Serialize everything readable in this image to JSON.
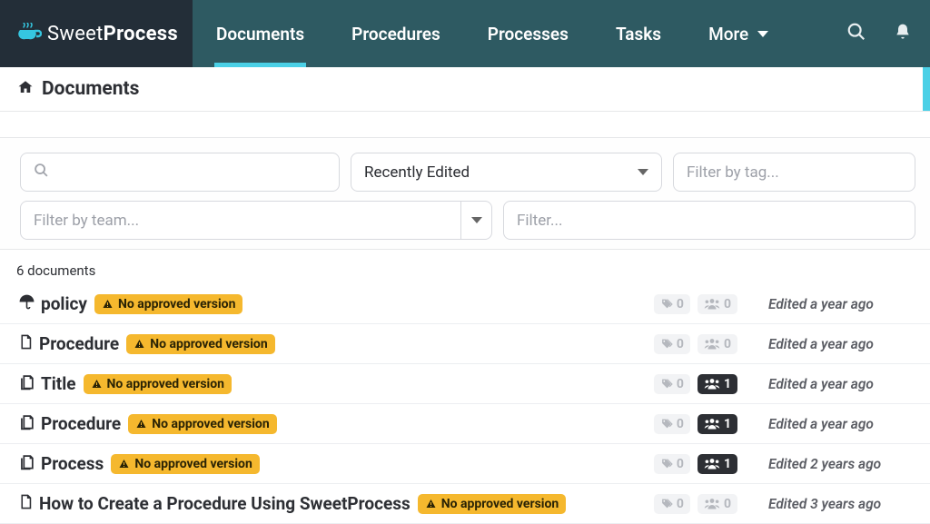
{
  "brand": {
    "sweet": "Sweet",
    "process": "Process"
  },
  "nav": {
    "items": [
      {
        "label": "Documents",
        "active": true
      },
      {
        "label": "Procedures"
      },
      {
        "label": "Processes"
      },
      {
        "label": "Tasks"
      },
      {
        "label": "More",
        "chevron": true
      }
    ]
  },
  "page": {
    "title": "Documents"
  },
  "filters": {
    "sort": {
      "value": "Recently Edited"
    },
    "tag": {
      "placeholder": "Filter by tag..."
    },
    "team": {
      "placeholder": "Filter by team..."
    },
    "filter": {
      "placeholder": "Filter..."
    }
  },
  "count_text": "6 documents",
  "badge_label": "No approved version",
  "rows": [
    {
      "icon": "umbrella",
      "name": "policy",
      "tags": "0",
      "users": "0",
      "users_dark": false,
      "edited": "Edited a year ago"
    },
    {
      "icon": "doc",
      "name": "Procedure",
      "tags": "0",
      "users": "0",
      "users_dark": false,
      "edited": "Edited a year ago"
    },
    {
      "icon": "docs",
      "name": "Title",
      "tags": "0",
      "users": "1",
      "users_dark": true,
      "edited": "Edited a year ago"
    },
    {
      "icon": "docs",
      "name": "Procedure",
      "tags": "0",
      "users": "1",
      "users_dark": true,
      "edited": "Edited a year ago"
    },
    {
      "icon": "docs",
      "name": "Process",
      "tags": "0",
      "users": "1",
      "users_dark": true,
      "edited": "Edited 2 years ago"
    },
    {
      "icon": "doc",
      "name": "How to Create a Procedure Using SweetProcess",
      "tags": "0",
      "users": "0",
      "users_dark": false,
      "edited": "Edited 3 years ago"
    }
  ]
}
